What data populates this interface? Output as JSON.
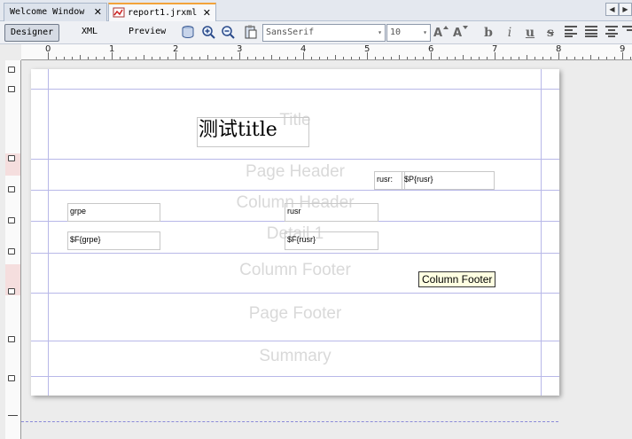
{
  "tabs": [
    {
      "label": "Welcome Window",
      "close": "✕"
    },
    {
      "label": "report1.jrxml",
      "close": "✕"
    }
  ],
  "nav": {
    "prev": "◀",
    "next": "▶"
  },
  "toolbar": {
    "designer": "Designer",
    "xml": "XML",
    "preview": "Preview",
    "font_family": "SansSerif",
    "font_size": "10",
    "combo_arrow": "▾",
    "format_bold": "b",
    "format_italic": "i",
    "format_underline": "u",
    "format_strike": "s"
  },
  "ruler": {
    "h_numbers": [
      "0",
      "1",
      "2",
      "3",
      "4",
      "5",
      "6",
      "7",
      "8",
      "9"
    ]
  },
  "report": {
    "bands": {
      "title": "Title",
      "page_header": "Page Header",
      "column_header": "Column Header",
      "detail": "Detail 1",
      "column_footer": "Column Footer",
      "page_footer": "Page Footer",
      "summary": "Summary"
    },
    "elements": {
      "title_text": "测试title",
      "param_label": "rusr:",
      "param_value": "$P{rusr}",
      "header_grpe": "grpe",
      "header_rusr": "rusr",
      "detail_grpe": "$F{grpe}",
      "detail_rusr": "$F{rusr}"
    },
    "tooltip": "Column Footer"
  }
}
